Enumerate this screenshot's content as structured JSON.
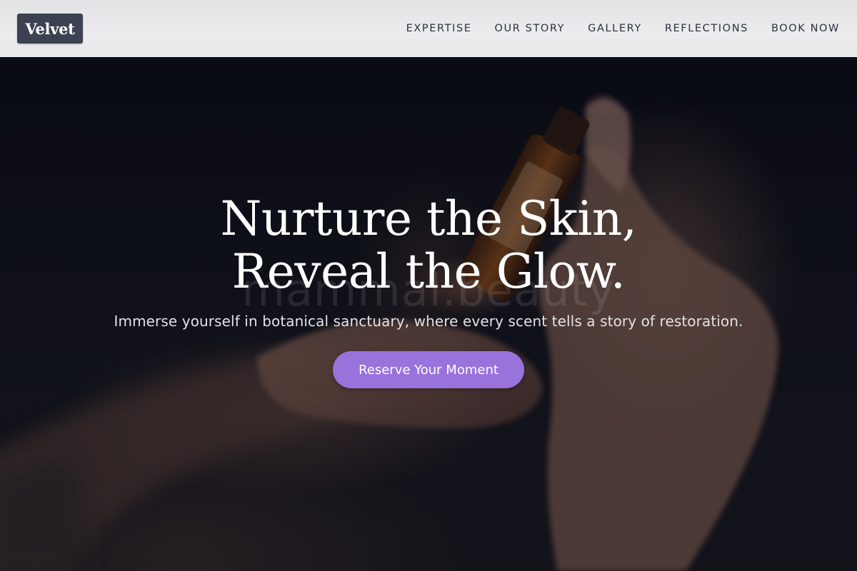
{
  "header": {
    "brand": "Velvet",
    "nav": [
      {
        "label": "EXPERTISE"
      },
      {
        "label": "OUR STORY"
      },
      {
        "label": "GALLERY"
      },
      {
        "label": "REFLECTIONS"
      },
      {
        "label": "BOOK NOW"
      }
    ]
  },
  "hero": {
    "title": "Nurture the Skin, Reveal the Glow.",
    "subtitle": "Immerse yourself in botanical sanctuary, where every scent tells a story of restoration.",
    "cta_label": "Reserve Your Moment",
    "watermark": "mammal.beauty",
    "image_subject": "hands-holding-amber-oil-bottle"
  },
  "colors": {
    "brand_bg": "#3d4252",
    "cta_bg": "#9a72dc",
    "header_bg": "#e9e9eb",
    "hero_dark": "#0b0d14"
  }
}
